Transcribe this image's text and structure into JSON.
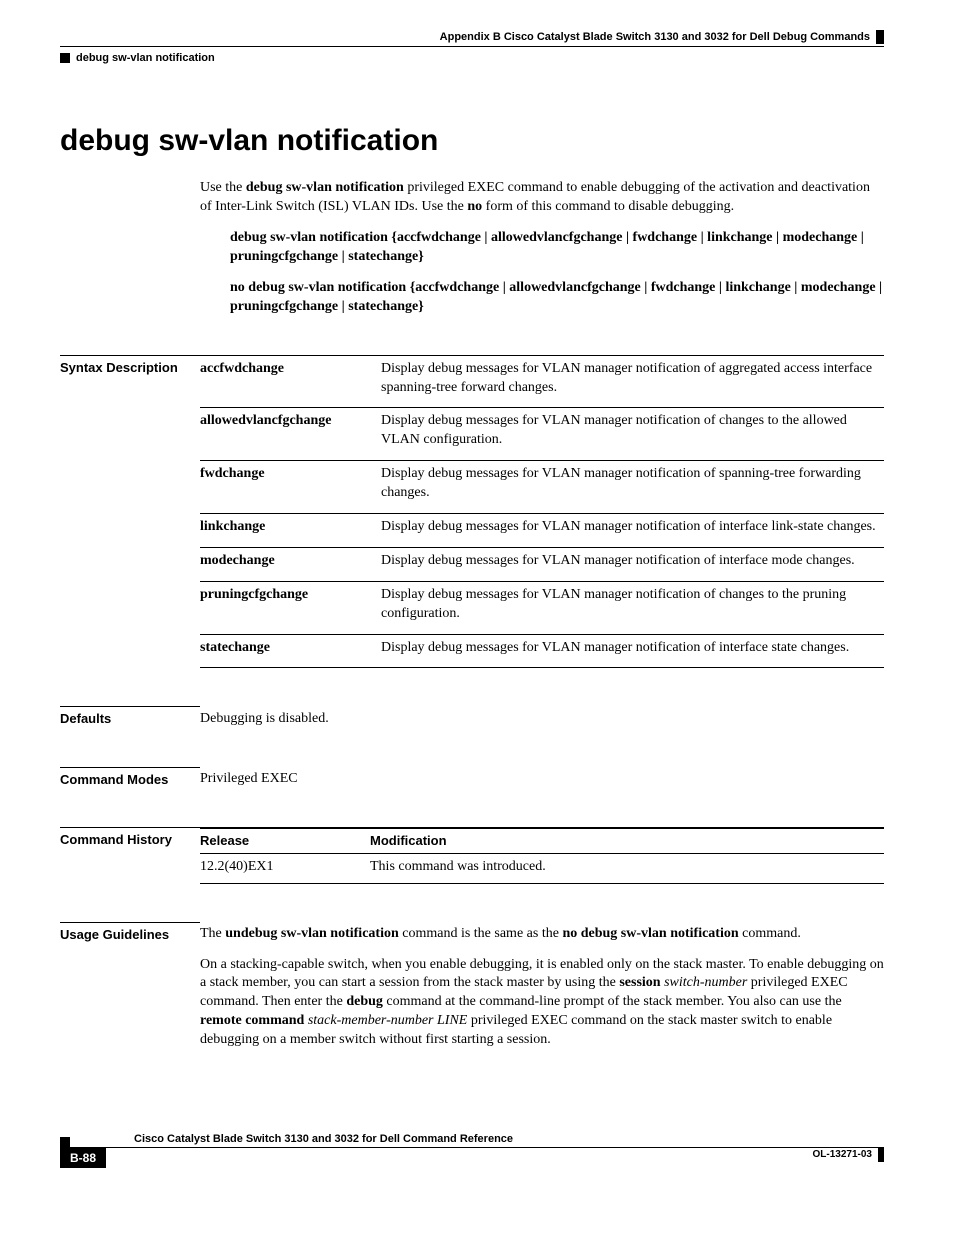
{
  "header": {
    "appendix": "Appendix B      Cisco Catalyst Blade Switch 3130 and 3032 for Dell Debug Commands",
    "topic": "debug sw-vlan notification"
  },
  "title": "debug sw-vlan notification",
  "intro": {
    "pre1": "Use the ",
    "cmd1": "debug sw-vlan notification",
    "mid1": " privileged EXEC command to enable debugging of the activation and deactivation of Inter-Link Switch (ISL) VLAN IDs. Use the ",
    "cmd2": "no",
    "post1": " form of this command to disable debugging."
  },
  "syntax_forms": {
    "form1_lead": "debug sw-vlan notification",
    "form1_rest": " {accfwdchange | allowedvlancfgchange | fwdchange | linkchange | modechange | pruningcfgchange | statechange}",
    "form2_lead": "no debug sw-vlan notification",
    "form2_rest": " {accfwdchange | allowedvlancfgchange | fwdchange | linkchange | modechange | pruningcfgchange | statechange}"
  },
  "sections": {
    "syntax_label": "Syntax Description",
    "defaults_label": "Defaults",
    "modes_label": "Command Modes",
    "history_label": "Command History",
    "usage_label": "Usage Guidelines"
  },
  "syntax_rows": [
    {
      "key": "accfwdchange",
      "desc": "Display debug messages for VLAN manager notification of aggregated access interface spanning-tree forward changes."
    },
    {
      "key": "allowedvlancfgchange",
      "desc": "Display debug messages for VLAN manager notification of changes to the allowed VLAN configuration."
    },
    {
      "key": "fwdchange",
      "desc": "Display debug messages for VLAN manager notification of spanning-tree forwarding changes."
    },
    {
      "key": "linkchange",
      "desc": "Display debug messages for VLAN manager notification of interface link-state changes."
    },
    {
      "key": "modechange",
      "desc": "Display debug messages for VLAN manager notification of interface mode changes."
    },
    {
      "key": "pruningcfgchange",
      "desc": "Display debug messages for VLAN manager notification of changes to the pruning configuration."
    },
    {
      "key": "statechange",
      "desc": "Display debug messages for VLAN manager notification of interface state changes."
    }
  ],
  "defaults_text": "Debugging is disabled.",
  "modes_text": "Privileged EXEC",
  "history": {
    "col1": "Release",
    "col2": "Modification",
    "rows": [
      {
        "release": "12.2(40)EX1",
        "mod": "This command was introduced."
      }
    ]
  },
  "usage": {
    "p1_pre": "The ",
    "p1_b1": "undebug sw-vlan notification",
    "p1_mid": " command is the same as the ",
    "p1_b2": "no debug sw-vlan notification",
    "p1_post": " command.",
    "p2_a": "On a stacking-capable switch, when you enable debugging, it is enabled only on the stack master. To enable debugging on a stack member, you can start a session from the stack master by using the ",
    "p2_b1": "session",
    "p2_i1": " switch-number",
    "p2_b": " privileged EXEC command. Then enter the ",
    "p2_b2": "debug",
    "p2_c": " command at the command-line prompt of the stack member. You also can use the ",
    "p2_b3": "remote command",
    "p2_i2": " stack-member-number LINE",
    "p2_d": " privileged EXEC command on the stack master switch to enable debugging on a member switch without first starting a session."
  },
  "footer": {
    "manual": "Cisco Catalyst Blade Switch 3130 and 3032 for Dell Command Reference",
    "page": "B-88",
    "docid": "OL-13271-03"
  }
}
